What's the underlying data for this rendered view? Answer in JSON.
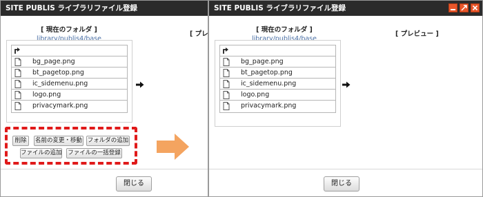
{
  "dialog": {
    "title": "SITE PUBLIS ライブラリファイル登録",
    "current_folder_label": "[ 現在のフォルダ ]",
    "current_folder_path": "library/publis4/base",
    "preview_label_left": "[ プレビュ",
    "preview_label": "[ プレビュー ]",
    "files": [
      "bg_page.png",
      "bt_pagetop.png",
      "ic_sidemenu.png",
      "logo.png",
      "privacymark.png"
    ],
    "close_label": "閉じる"
  },
  "actions": {
    "delete": "削除",
    "rename_move": "名前の変更・移動",
    "add_folder": "フォルダの追加",
    "add_file": "ファイルの追加",
    "bulk_register": "ファイルの一括登録"
  },
  "colors": {
    "titlebar": "#2b2b2b",
    "window_buttons": "#e8562a",
    "highlight_dash": "#e01a1a",
    "transition_arrow": "#f4a460",
    "path_text": "#4a6fa5"
  },
  "icons": {
    "up": "up-folder-icon",
    "file": "file-icon",
    "expand": "arrow-right-icon",
    "minimize": "minimize-icon",
    "maximize": "maximize-icon",
    "close": "close-icon",
    "transition": "transition-arrow-icon"
  }
}
